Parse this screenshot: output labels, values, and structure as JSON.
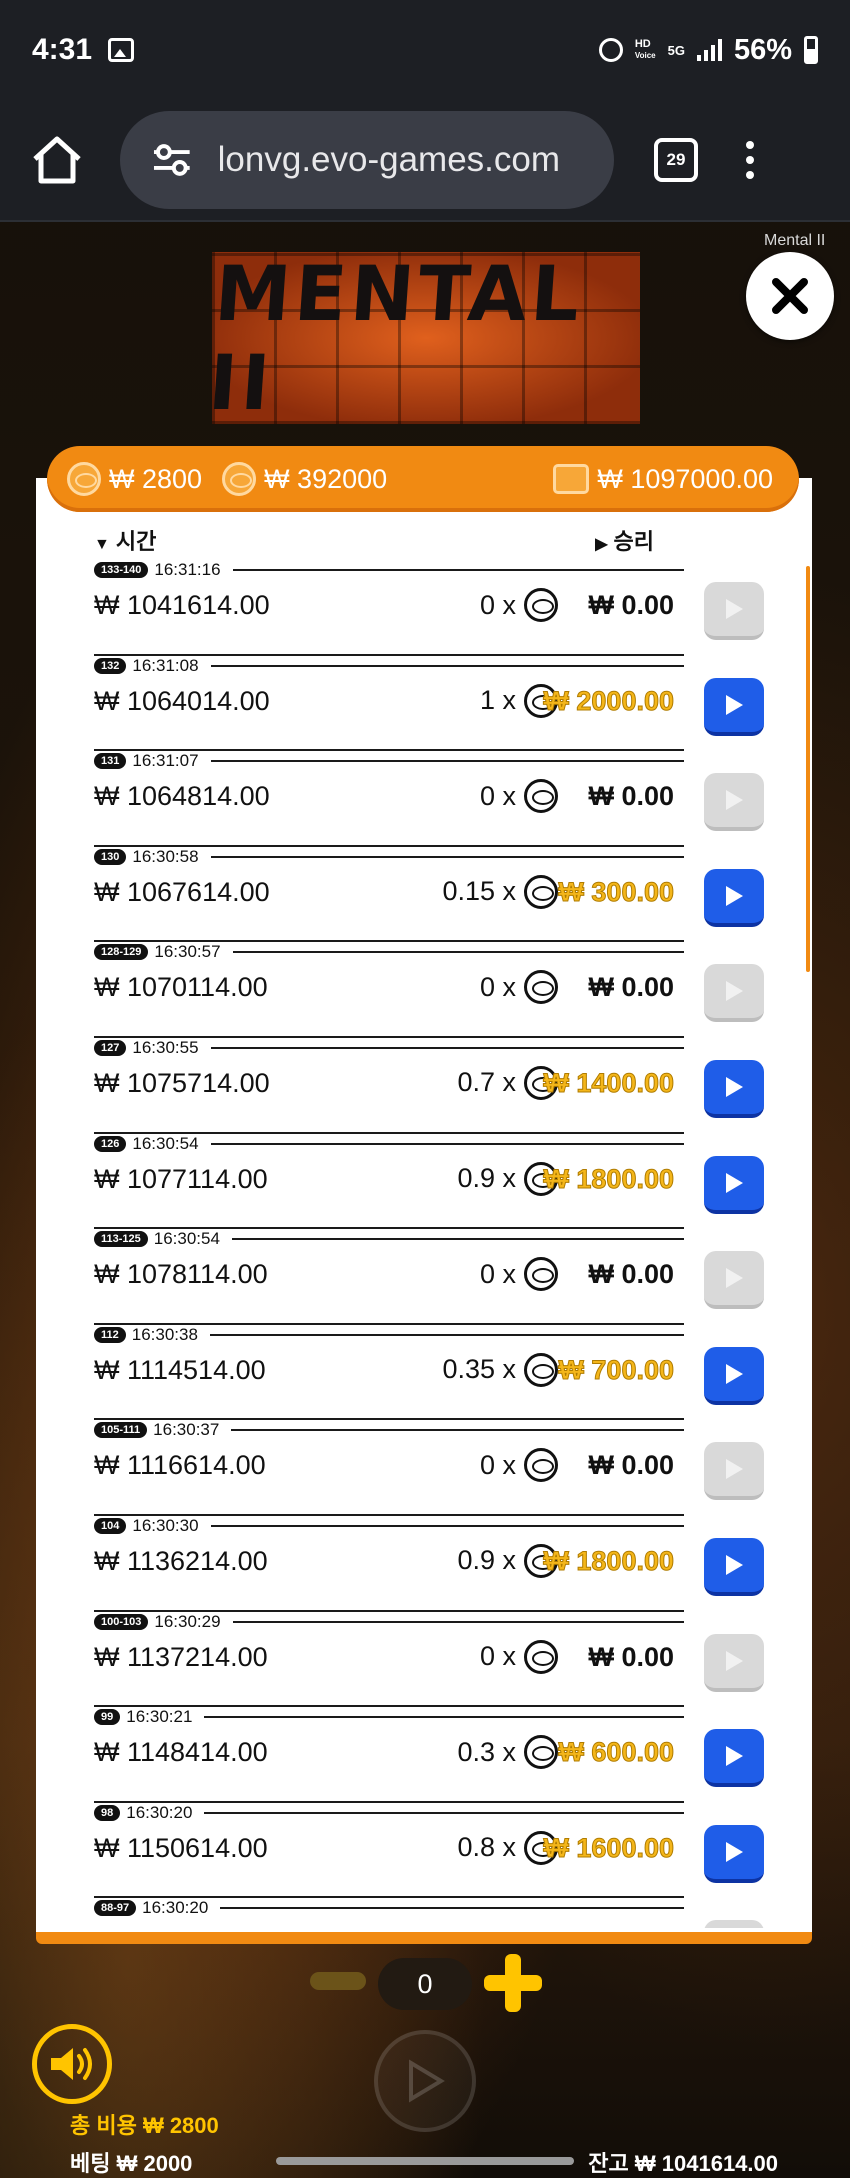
{
  "status_bar": {
    "time": "4:31",
    "net_top": "HD",
    "net_bottom": "Voice",
    "net_gen": "5G",
    "battery": "56%"
  },
  "browser": {
    "url": "lonvg.evo-games.com",
    "tab_count": "29"
  },
  "game": {
    "logo_text": "MENTAL II",
    "title": "Mental II"
  },
  "header": {
    "cost_a": "₩ 2800",
    "cost_b": "₩ 392000",
    "balance": "₩ 1097000.00"
  },
  "columns": {
    "time": "시간",
    "win": "승리"
  },
  "history": [
    {
      "round": "133-140",
      "time": "16:31:16",
      "balance": "₩ 1041614.00",
      "mult": "0 x",
      "win": "₩ 0.00",
      "gold": false
    },
    {
      "round": "132",
      "time": "16:31:08",
      "balance": "₩ 1064014.00",
      "mult": "1 x",
      "win": "₩ 2000.00",
      "gold": true
    },
    {
      "round": "131",
      "time": "16:31:07",
      "balance": "₩ 1064814.00",
      "mult": "0 x",
      "win": "₩ 0.00",
      "gold": false
    },
    {
      "round": "130",
      "time": "16:30:58",
      "balance": "₩ 1067614.00",
      "mult": "0.15 x",
      "win": "₩ 300.00",
      "gold": true
    },
    {
      "round": "128-129",
      "time": "16:30:57",
      "balance": "₩ 1070114.00",
      "mult": "0 x",
      "win": "₩ 0.00",
      "gold": false
    },
    {
      "round": "127",
      "time": "16:30:55",
      "balance": "₩ 1075714.00",
      "mult": "0.7 x",
      "win": "₩ 1400.00",
      "gold": true
    },
    {
      "round": "126",
      "time": "16:30:54",
      "balance": "₩ 1077114.00",
      "mult": "0.9 x",
      "win": "₩ 1800.00",
      "gold": true
    },
    {
      "round": "113-125",
      "time": "16:30:54",
      "balance": "₩ 1078114.00",
      "mult": "0 x",
      "win": "₩ 0.00",
      "gold": false
    },
    {
      "round": "112",
      "time": "16:30:38",
      "balance": "₩ 1114514.00",
      "mult": "0.35 x",
      "win": "₩ 700.00",
      "gold": true
    },
    {
      "round": "105-111",
      "time": "16:30:37",
      "balance": "₩ 1116614.00",
      "mult": "0 x",
      "win": "₩ 0.00",
      "gold": false
    },
    {
      "round": "104",
      "time": "16:30:30",
      "balance": "₩ 1136214.00",
      "mult": "0.9 x",
      "win": "₩ 1800.00",
      "gold": true
    },
    {
      "round": "100-103",
      "time": "16:30:29",
      "balance": "₩ 1137214.00",
      "mult": "0 x",
      "win": "₩ 0.00",
      "gold": false
    },
    {
      "round": "99",
      "time": "16:30:21",
      "balance": "₩ 1148414.00",
      "mult": "0.3 x",
      "win": "₩ 600.00",
      "gold": true
    },
    {
      "round": "98",
      "time": "16:30:20",
      "balance": "₩ 1150614.00",
      "mult": "0.8 x",
      "win": "₩ 1600.00",
      "gold": true
    },
    {
      "round": "88-97",
      "time": "16:30:20",
      "balance": "",
      "mult": "",
      "win": "",
      "gold": false
    }
  ],
  "controls": {
    "count": "0"
  },
  "footer": {
    "total_cost": "총 비용  ₩ 2800",
    "bet": "베팅  ₩ 2000",
    "balance": "잔고  ₩ 1041614.00"
  },
  "colors": {
    "accent": "#f18a12",
    "gold": "#ffc400",
    "play_active": "#1f5de8"
  }
}
